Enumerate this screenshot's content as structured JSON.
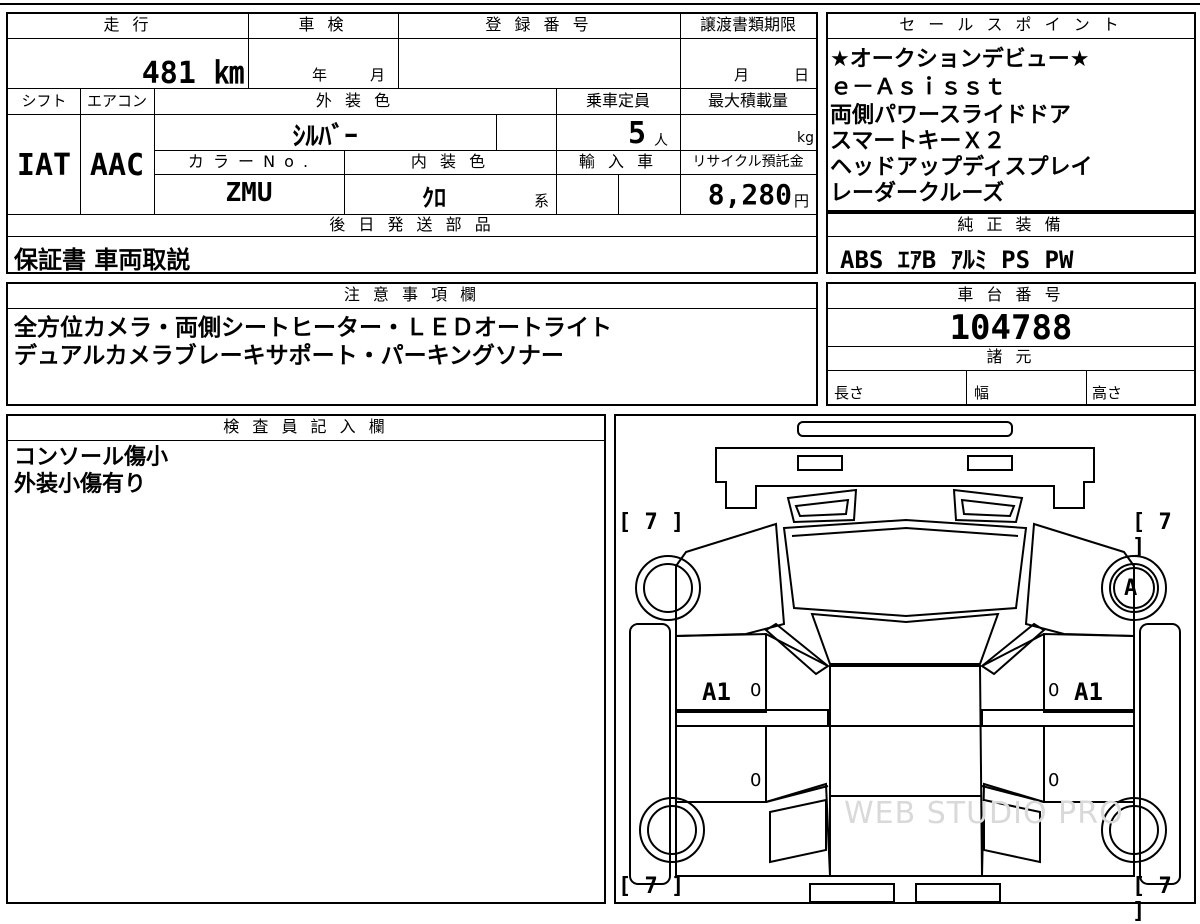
{
  "top_table": {
    "mileage": {
      "header": "走 行",
      "value": "481 ㎞"
    },
    "shaken": {
      "header": "車 検",
      "year_label": "年",
      "month_label": "月"
    },
    "registration": {
      "header": "登 録 番 号"
    },
    "transfer_deadline": {
      "header": "譲渡書類期限",
      "month_label": "月",
      "day_label": "日"
    },
    "shift": {
      "header": "シフト",
      "value": "IAT"
    },
    "aircon": {
      "header": "エアコン",
      "value": "AAC"
    },
    "exterior_color": {
      "header": "外 装 色",
      "value": "ｼﾙﾊﾞｰ"
    },
    "capacity": {
      "header": "乗車定員",
      "value": "5",
      "unit": "人"
    },
    "max_load": {
      "header": "最大積載量",
      "unit": "kg"
    },
    "color_no": {
      "header": "カ ラ ー N o .",
      "value": "ZMU"
    },
    "interior_color": {
      "header": "内 装 色",
      "value": "ｸﾛ",
      "suffix": "系"
    },
    "import": {
      "header": "輸 入 車"
    },
    "recycle": {
      "header": "リサイクル預託金",
      "value": "8,280",
      "unit": "円"
    },
    "later_parts": {
      "header": "後 日 発 送 部 品",
      "value": "保証書 車両取説"
    }
  },
  "sales_points": {
    "header": "セ ー ル ス ポ イ ン ト",
    "lines": [
      "★オークションデビュー★",
      "ｅ－Ａｓｉｓｓｔ",
      "両側パワースライドドア",
      "スマートキーＸ２",
      "ヘッドアップディスプレイ",
      "レーダークルーズ"
    ]
  },
  "standard_equipment": {
    "header": "純 正 装 備",
    "value": "ABS ｴｱB ｱﾙﾐ PS PW"
  },
  "notes": {
    "header": "注 意 事 項 欄",
    "lines": [
      "全方位カメラ・両側シートヒーター・ＬＥＤオートライト",
      "デュアルカメラブレーキサポート・パーキングソナー"
    ]
  },
  "chassis": {
    "header": "車 台 番 号",
    "value": "104788"
  },
  "specs": {
    "header": "諸 元",
    "length": "長さ",
    "width": "幅",
    "height": "高さ"
  },
  "inspector": {
    "header": "検 査 員 記 入 欄",
    "lines": [
      "コンソール傷小",
      "外装小傷有り"
    ]
  },
  "diagram": {
    "tire_tl": "[ 7 ]",
    "tire_tr": "[ 7 ]",
    "tire_bl": "[ 7 ]",
    "tire_br": "[ 7 ]",
    "mark_front_right_wheel": "A",
    "mark_left_front_door": "A1",
    "mark_right_front_door": "A1",
    "zero": "0",
    "watermark": "WEB STUDIO PRO"
  }
}
